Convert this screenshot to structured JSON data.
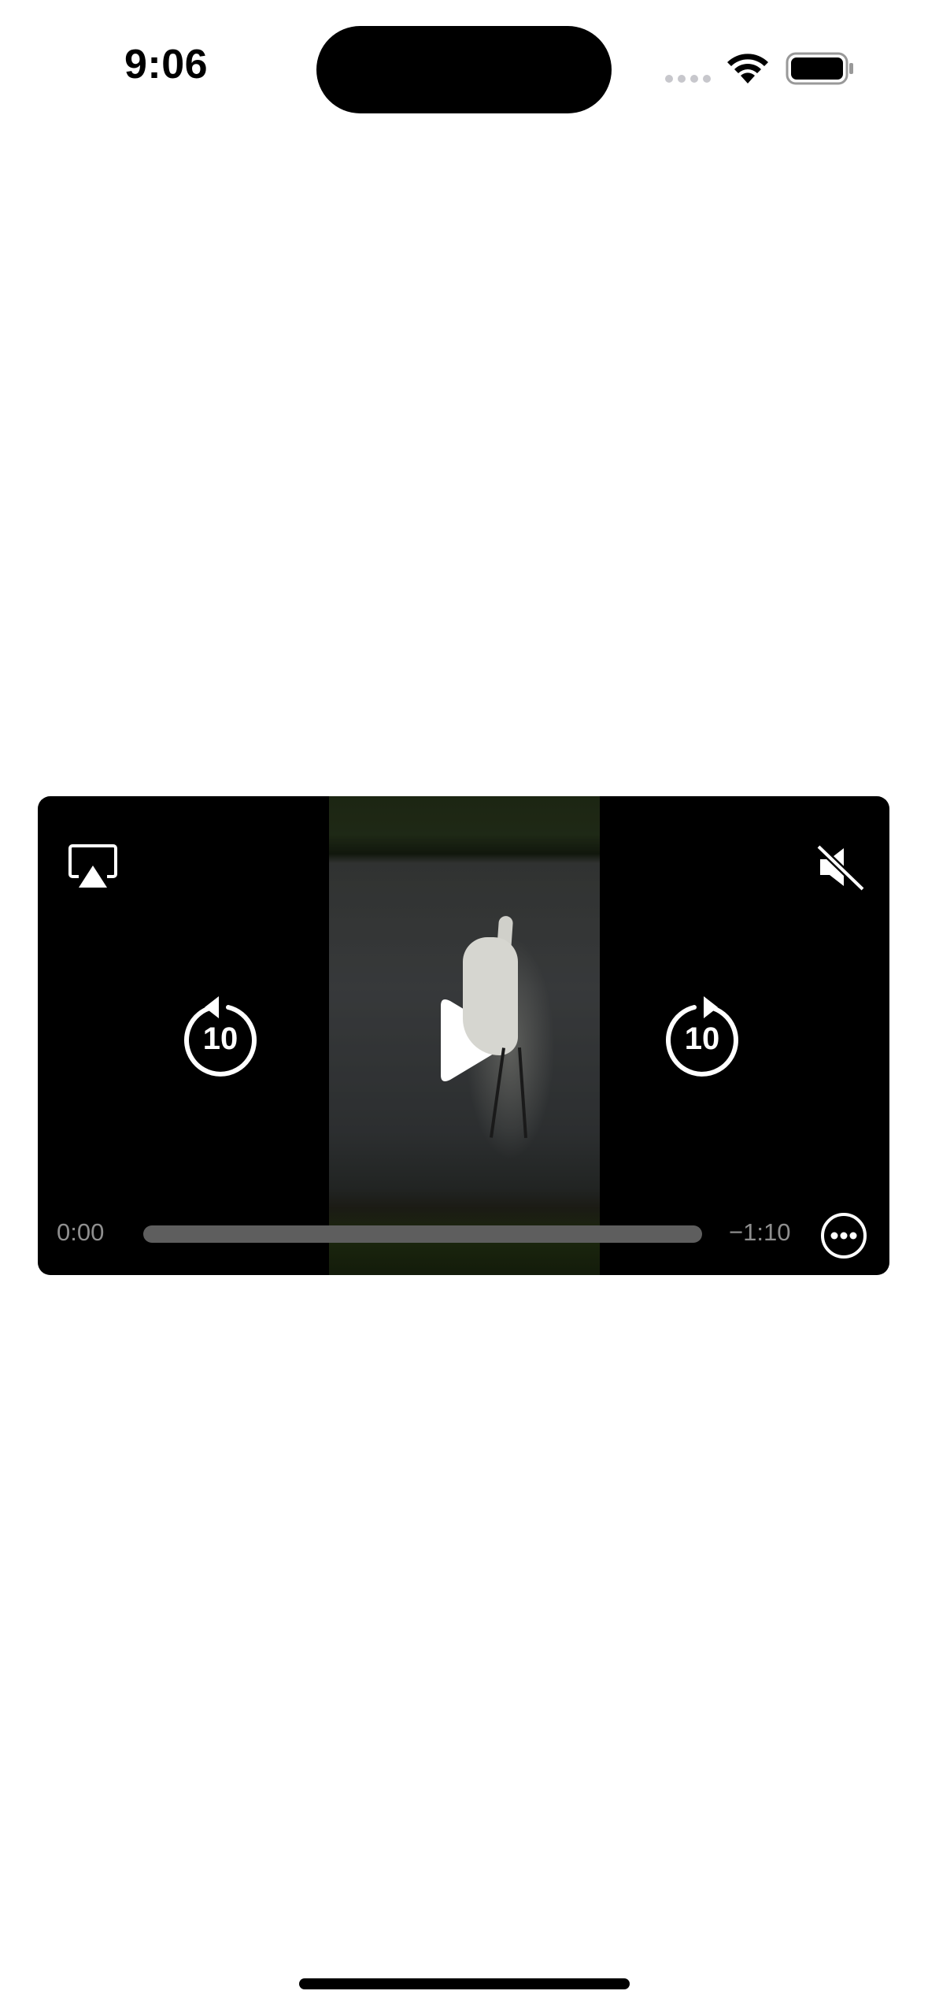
{
  "status_bar": {
    "time": "9:06",
    "icons": [
      "cellular-signal-icon",
      "wifi-icon",
      "battery-icon"
    ]
  },
  "player": {
    "current_time": "0:00",
    "remaining_time": "−1:10",
    "progress": 0,
    "skip_back_seconds": "10",
    "skip_forward_seconds": "10",
    "icons": [
      "airplay-icon",
      "mute-icon",
      "skip-back-icon",
      "play-icon",
      "skip-forward-icon",
      "more-icon"
    ]
  }
}
